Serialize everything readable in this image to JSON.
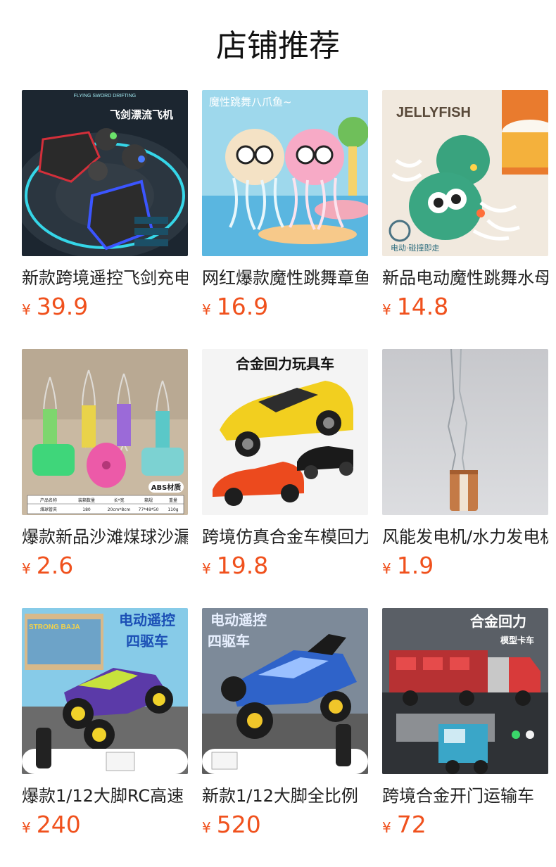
{
  "header": {
    "title": "店铺推荐"
  },
  "currency_symbol": "¥",
  "colors": {
    "price": "#f0511d",
    "title": "#111111"
  },
  "products": [
    {
      "name": "新款跨境遥控飞剑充电",
      "price": "39.9",
      "image_text": [
        "飞剑漂流飞机",
        "FLYING SWORD DRIFTING"
      ]
    },
    {
      "name": "网红爆款魔性跳舞章鱼",
      "price": "16.9",
      "image_text": [
        "魔性跳舞八爪鱼~"
      ]
    },
    {
      "name": "新品电动魔性跳舞水母",
      "price": "14.8",
      "image_text": [
        "JELLYFISH",
        "电动·碰撞即走"
      ]
    },
    {
      "name": "爆款新品沙滩煤球沙漏",
      "price": "2.6",
      "image_text": [
        "ABS材质",
        "产品名称",
        "装箱数量",
        "长*宽",
        "箱规",
        "重量",
        "煤球管夹",
        "180",
        "20cm*8cm",
        "77*48*50",
        "110g"
      ]
    },
    {
      "name": "跨境仿真合金车模回力",
      "price": "19.8",
      "image_text": [
        "合金回力玩具车"
      ]
    },
    {
      "name": "风能发电机/水力发电机",
      "price": "1.9",
      "image_text": []
    },
    {
      "name": "爆款1/12大脚RC高速",
      "price": "240",
      "image_text": [
        "电动遥控",
        "四驱车",
        "STRONG BAJA"
      ]
    },
    {
      "name": "新款1/12大脚全比例",
      "price": "520",
      "image_text": [
        "电动遥控",
        "四驱车"
      ]
    },
    {
      "name": "跨境合金开门运输车",
      "price": "72",
      "image_text": [
        "合金回力",
        "模型卡车"
      ]
    }
  ]
}
